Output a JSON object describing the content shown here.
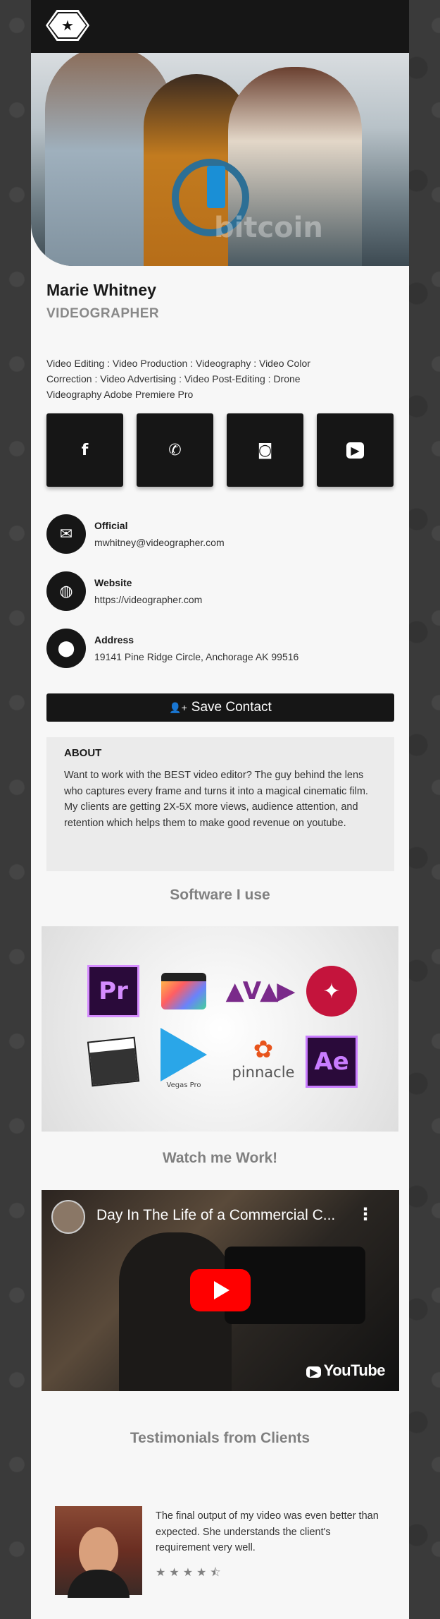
{
  "profile": {
    "name": "Marie Whitney",
    "title": "VIDEOGRAPHER",
    "skills": "Video Editing : Video Production : Videography : Video Color Correction : Video Advertising : Video Post-Editing : Drone Videography Adobe Premiere Pro"
  },
  "hero": {
    "watermark": "bitcoin"
  },
  "socials": [
    {
      "name": "facebook",
      "glyph": "f"
    },
    {
      "name": "phone",
      "glyph": "✆"
    },
    {
      "name": "instagram",
      "glyph": "◙"
    },
    {
      "name": "youtube",
      "glyph": "▶"
    }
  ],
  "contacts": {
    "official": {
      "label": "Official",
      "value": "mwhitney@videographer.com",
      "icon": "mail-icon"
    },
    "website": {
      "label": "Website",
      "value": "https://videographer.com",
      "icon": "globe-icon"
    },
    "address": {
      "label": "Address",
      "value": "19141 Pine Ridge Circle, Anchorage AK 99516",
      "icon": "location-pin-icon"
    }
  },
  "save_button": {
    "label": "Save Contact",
    "icon": "👤+"
  },
  "about": {
    "heading": "ABOUT",
    "text": "Want to work with the BEST video editor? The guy behind the lens who captures every frame and turns it into a magical cinematic film. My clients are getting 2X-5X more views, audience attention, and retention which helps them to make good revenue on youtube."
  },
  "sections": {
    "software": "Software I use",
    "work": "Watch me Work!",
    "testimonials": "Testimonials from Clients"
  },
  "software_logos": {
    "premiere": "Pr",
    "after_effects": "Ae",
    "vegas": "Vegas Pro",
    "pinnacle": "pinnacle"
  },
  "video": {
    "title": "Day In The Life of a Commercial C...",
    "menu": "⋮",
    "brand": "YouTube"
  },
  "testimonial": {
    "text": "The final output of my video was even better than expected. She understands the client's requirement very well.",
    "rating": 4.5,
    "stars": "★★★★⯪"
  },
  "colors": {
    "dark": "#161616",
    "page_bg": "#f7f7f7",
    "muted_heading": "#808080",
    "youtube_red": "#ff0000"
  }
}
